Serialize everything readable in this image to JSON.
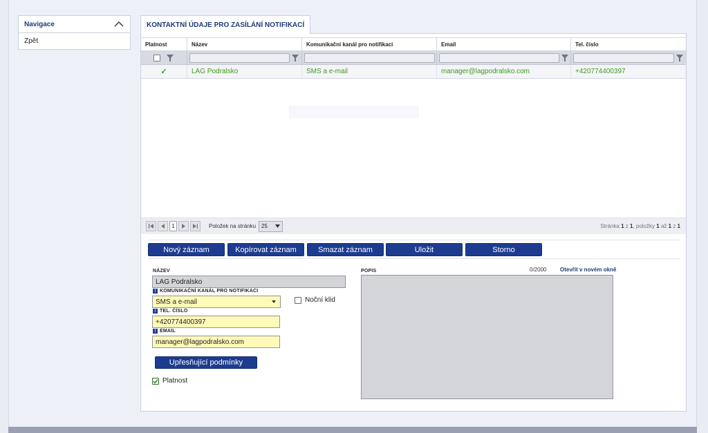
{
  "navigation": {
    "title": "Navigace",
    "items": [
      {
        "label": "Zpět"
      }
    ]
  },
  "tab": {
    "label": "KONTAKTNÍ ÚDAJE PRO ZASÍLÁNÍ NOTIFIKACÍ"
  },
  "grid": {
    "columns": [
      "Platnost",
      "Název",
      "Komunikační kanál pro notifikaci",
      "Email",
      "Tel. číslo"
    ],
    "rows": [
      {
        "platnost": "✓",
        "nazev": "LAG Podralsko",
        "kanal": "SMS a e-mail",
        "email": "manager@lagpodralsko.com",
        "tel": "+420774400397"
      }
    ]
  },
  "pager": {
    "current_page": "1",
    "page_size_label": "Položek na stránku",
    "page_size": "25",
    "info_stranka": "Stránka",
    "info_page": "1",
    "info_z": "z",
    "info_pages": "1",
    "info_polozky": ", položky",
    "info_from": "1",
    "info_az": "až",
    "info_to": "1",
    "info_z2": "z",
    "info_total": "1"
  },
  "toolbar": {
    "new": "Nový záznam",
    "copy": "Kopírovat záznam",
    "delete": "Smazat záznam",
    "save": "Uložit",
    "cancel": "Storno"
  },
  "form": {
    "name_label": "NÁZEV",
    "name_value": "LAG Podralsko",
    "channel_label": "KOMUNIKAČNÍ KANÁL PRO NOTIFIKACI",
    "channel_value": "SMS a e-mail",
    "night_label": "Noční klid",
    "phone_label": "TEL. ČÍSLO",
    "phone_value": "+420774400397",
    "email_label": "EMAIL",
    "email_value": "manager@lagpodralsko.com",
    "conditions_button": "Upřesňující podmínky",
    "valid_label": "Platnost",
    "description_label": "POPIS",
    "description_counter": "0/2000",
    "open_new_window": "Otevřít v novém okně",
    "required_marker": "!"
  },
  "colors": {
    "accent": "#1d3c8f",
    "row_text": "#3f9a1e",
    "required_bg": "#fffab8"
  }
}
